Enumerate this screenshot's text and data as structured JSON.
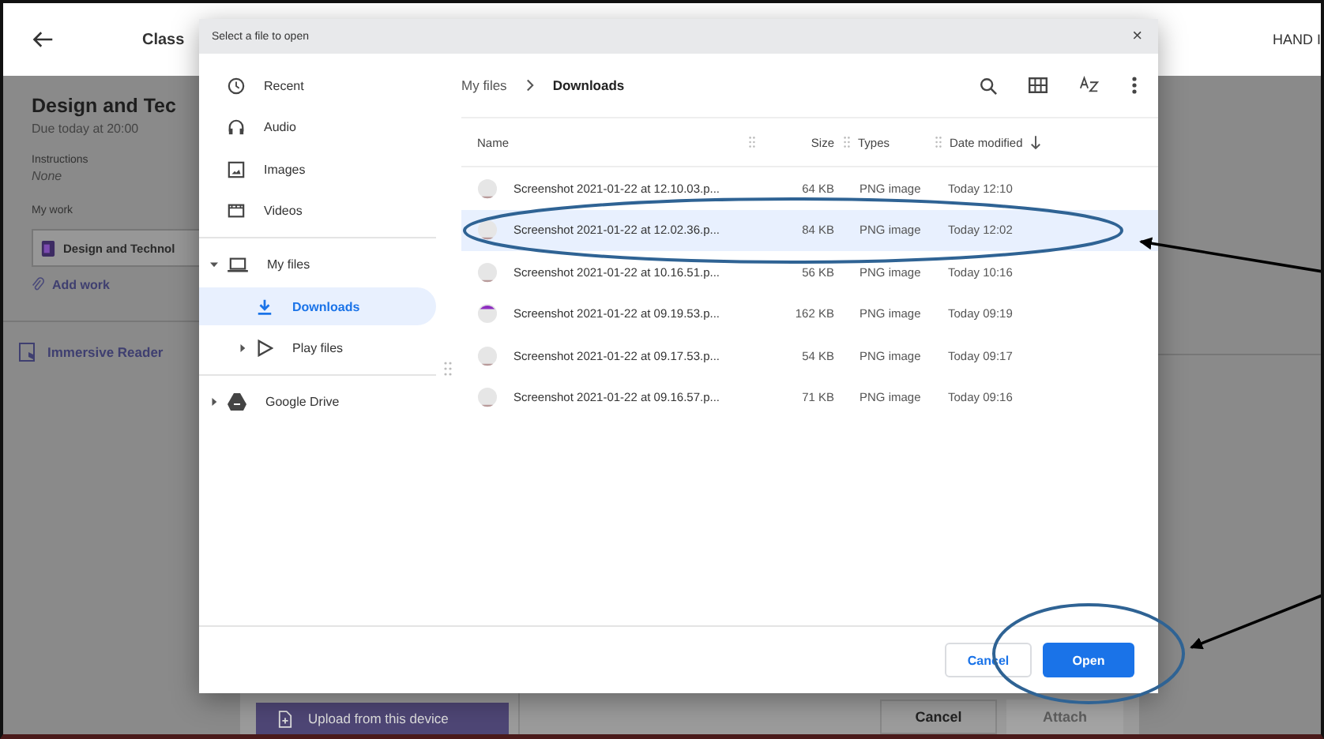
{
  "background_app": {
    "header": {
      "title": "Class",
      "action": "HAND I"
    },
    "assignment": {
      "title": "Design and Tec",
      "due": "Due today at 20:00",
      "instructions_label": "Instructions",
      "instructions": "None",
      "my_work_label": "My work",
      "attachment": "Design and Technol",
      "add_work": "Add work",
      "immersive_reader": "Immersive Reader"
    },
    "upload_panel": {
      "upload_button": "Upload from this device",
      "cancel": "Cancel",
      "attach": "Attach",
      "attach_disabled": true
    }
  },
  "dialog": {
    "title": "Select a file to open",
    "close": "×",
    "sidebar_sections": [
      {
        "items": [
          {
            "label": "Recent",
            "selected": false
          },
          {
            "label": "Audio",
            "selected": false
          },
          {
            "label": "Images",
            "selected": false
          },
          {
            "label": "Videos",
            "selected": false
          }
        ]
      },
      {
        "items": [
          {
            "label": "My files",
            "selected": false,
            "expanded": true,
            "children": [
              {
                "label": "Downloads",
                "selected": true
              },
              {
                "label": "Play files",
                "selected": false,
                "expanded": false
              }
            ]
          }
        ]
      },
      {
        "items": [
          {
            "label": "Google Drive",
            "selected": false,
            "expanded": false
          }
        ]
      }
    ],
    "breadcrumb": [
      "My files",
      "Downloads"
    ],
    "columns": [
      {
        "label": "Name"
      },
      {
        "label": "Size"
      },
      {
        "label": "Types"
      },
      {
        "label": "Date modified",
        "sorted": true
      }
    ],
    "files": [
      {
        "name": "Screenshot 2021-01-22 at 12.10.03.p...",
        "size": "64 KB",
        "type": "PNG image",
        "modified": "Today 12:10",
        "selected": false
      },
      {
        "name": "Screenshot 2021-01-22 at 12.02.36.p...",
        "size": "84 KB",
        "type": "PNG image",
        "modified": "Today 12:02",
        "selected": true
      },
      {
        "name": "Screenshot 2021-01-22 at 10.16.51.p...",
        "size": "56 KB",
        "type": "PNG image",
        "modified": "Today 10:16",
        "selected": false
      },
      {
        "name": "Screenshot 2021-01-22 at 09.19.53.p...",
        "size": "162 KB",
        "type": "PNG image",
        "modified": "Today 09:19",
        "selected": false
      },
      {
        "name": "Screenshot 2021-01-22 at 09.17.53.p...",
        "size": "54 KB",
        "type": "PNG image",
        "modified": "Today 09:17",
        "selected": false
      },
      {
        "name": "Screenshot 2021-01-22 at 09.16.57.p...",
        "size": "71 KB",
        "type": "PNG image",
        "modified": "Today 09:16",
        "selected": false
      }
    ],
    "buttons": [
      {
        "label": "Cancel",
        "kind": "secondary"
      },
      {
        "label": "Open",
        "kind": "primary"
      }
    ]
  }
}
